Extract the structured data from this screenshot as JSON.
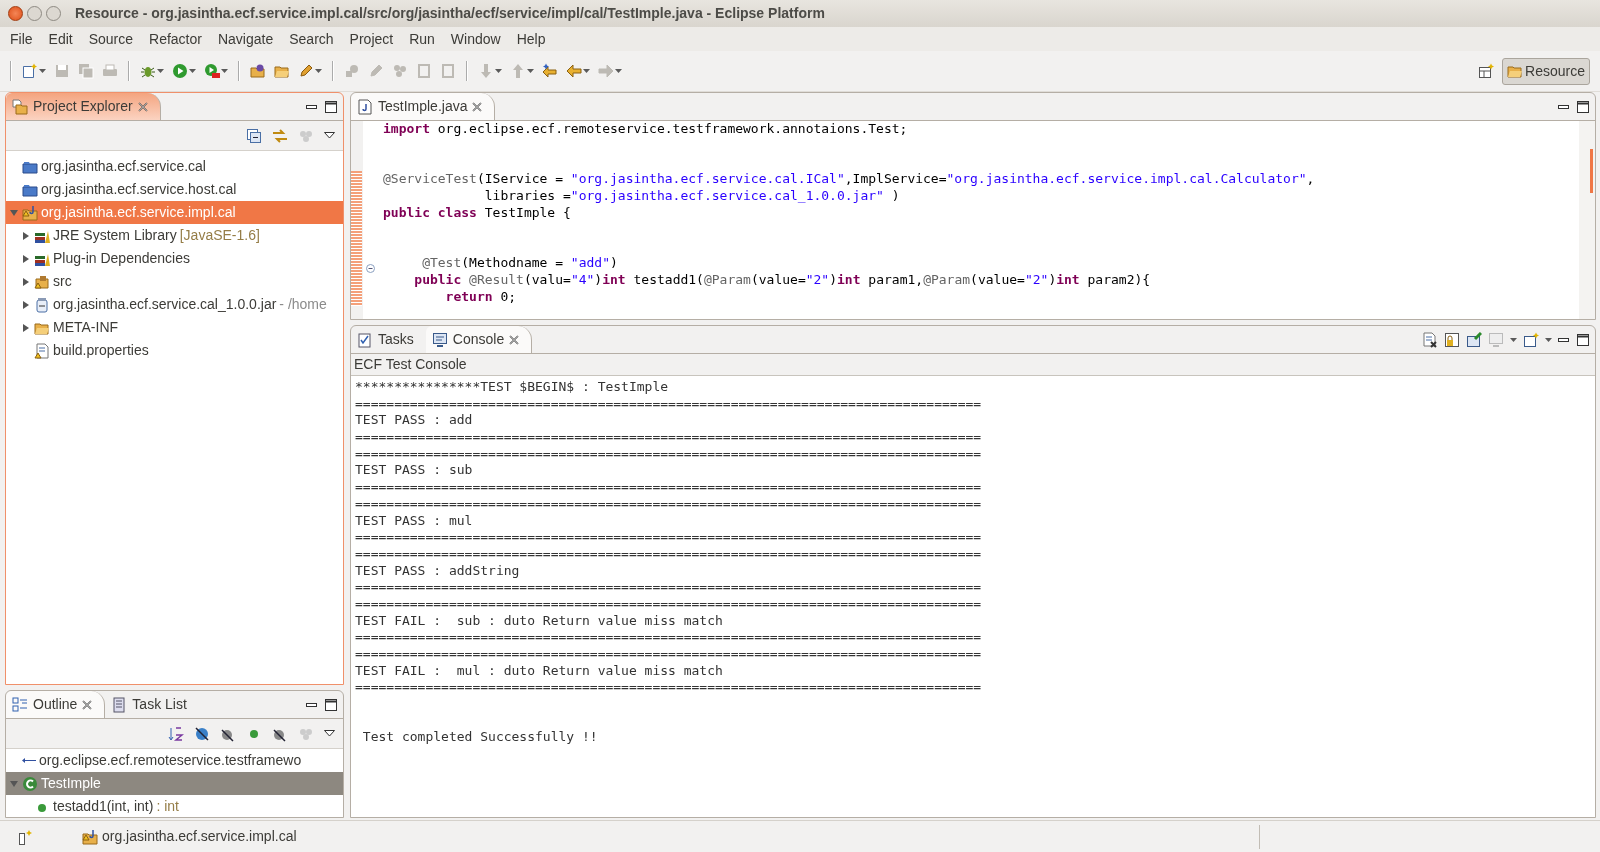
{
  "window": {
    "title": "Resource - org.jasintha.ecf.service.impl.cal/src/org/jasintha/ecf/service/impl/cal/TestImple.java - Eclipse Platform"
  },
  "menu": [
    "File",
    "Edit",
    "Source",
    "Refactor",
    "Navigate",
    "Search",
    "Project",
    "Run",
    "Window",
    "Help"
  ],
  "toolbar": [
    [
      {
        "kind": "new",
        "disabled": false,
        "dropdown": true
      },
      {
        "kind": "save",
        "disabled": true
      },
      {
        "kind": "save_all",
        "disabled": true
      },
      {
        "kind": "print",
        "disabled": true
      }
    ],
    [
      {
        "kind": "debug",
        "disabled": false,
        "dropdown": true
      },
      {
        "kind": "run",
        "disabled": false,
        "dropdown": true
      },
      {
        "kind": "external",
        "disabled": false,
        "dropdown": true
      }
    ],
    [
      {
        "kind": "open_type",
        "disabled": false
      },
      {
        "kind": "open_folder",
        "disabled": false
      },
      {
        "kind": "pen",
        "disabled": false,
        "dropdown": true
      }
    ],
    [
      {
        "kind": "marker",
        "disabled": true
      },
      {
        "kind": "pen",
        "disabled": true
      },
      {
        "kind": "dots",
        "disabled": true
      },
      {
        "kind": "square",
        "disabled": true
      },
      {
        "kind": "square",
        "disabled": true
      }
    ],
    [
      {
        "kind": "down",
        "disabled": true,
        "dropdown": true
      },
      {
        "kind": "up",
        "disabled": true,
        "dropdown": true
      },
      {
        "kind": "last_edit",
        "disabled": false
      },
      {
        "kind": "back",
        "disabled": false,
        "dropdown": true
      },
      {
        "kind": "forward",
        "disabled": true,
        "dropdown": true
      }
    ]
  ],
  "perspectives": [
    {
      "label": "Resource",
      "selected": true
    }
  ],
  "project_explorer": {
    "title": "Project Explorer",
    "tree": [
      {
        "label": "org.jasintha.ecf.service.cal",
        "kind": "closed_project",
        "selected": false
      },
      {
        "label": "org.jasintha.ecf.service.host.cal",
        "kind": "closed_project",
        "selected": false
      },
      {
        "label": "org.jasintha.ecf.service.impl.cal",
        "kind": "project",
        "selected": true,
        "expanded": true,
        "children": [
          {
            "label": "JRE System Library",
            "suffix": "[JavaSE-1.6]",
            "kind": "library",
            "selected": false,
            "expanded": false
          },
          {
            "label": "Plug-in Dependencies",
            "kind": "library",
            "selected": false,
            "expanded": false
          },
          {
            "label": "src",
            "kind": "source",
            "selected": false,
            "expanded": false
          },
          {
            "label": "org.jasintha.ecf.service.cal_1.0.0.jar",
            "suffix": "- /home",
            "kind": "jar",
            "selected": false,
            "expanded": false
          },
          {
            "label": "META-INF",
            "kind": "folder",
            "selected": false,
            "expanded": false
          },
          {
            "label": "build.properties",
            "kind": "file",
            "selected": false
          }
        ]
      }
    ]
  },
  "outline": {
    "tabs": [
      {
        "label": "Outline",
        "selected": true
      },
      {
        "label": "Task List",
        "selected": false
      }
    ],
    "items": [
      {
        "label": "org.eclipse.ecf.remoteservice.testframewo",
        "kind": "imports",
        "selected": false
      },
      {
        "label": "TestImple",
        "kind": "class",
        "selected": true,
        "expanded": true,
        "children": [
          {
            "label": "testadd1(int, int)",
            "suffix": ": int",
            "kind": "method",
            "selected": false
          }
        ]
      }
    ]
  },
  "editor": {
    "tabs": [
      {
        "label": "TestImple.java",
        "selected": true
      }
    ],
    "lines": [
      {
        "kind": "code",
        "segments": [
          {
            "kind": "keyword",
            "text": "import"
          },
          {
            "kind": "plain",
            "text": " org.eclipse.ecf.remoteservice.testframework.annotaions.Test;"
          }
        ]
      },
      {
        "kind": "blank"
      },
      {
        "kind": "blank"
      },
      {
        "kind": "code",
        "segments": [
          {
            "kind": "annotation",
            "text": "@ServiceTest"
          },
          {
            "kind": "plain",
            "text": "(IService = "
          },
          {
            "kind": "string",
            "text": "\"org.jasintha.ecf.service.cal.ICal\""
          },
          {
            "kind": "plain",
            "text": ",ImplService="
          },
          {
            "kind": "string",
            "text": "\"org.jasintha.ecf.service.impl.cal.Calculator\""
          },
          {
            "kind": "plain",
            "text": ","
          }
        ]
      },
      {
        "kind": "code",
        "segments": [
          {
            "kind": "plain",
            "text": "             libraries ="
          },
          {
            "kind": "string",
            "text": "\"org.jasintha.ecf.service.cal_1.0.0.jar\""
          },
          {
            "kind": "plain",
            "text": " )"
          }
        ]
      },
      {
        "kind": "code",
        "segments": [
          {
            "kind": "keyword",
            "text": "public class"
          },
          {
            "kind": "plain",
            "text": " TestImple {"
          }
        ]
      },
      {
        "kind": "blank"
      },
      {
        "kind": "blank"
      },
      {
        "kind": "code",
        "folded": false,
        "segments": [
          {
            "kind": "annotation",
            "text": "     @Test"
          },
          {
            "kind": "plain",
            "text": "(Methodname = "
          },
          {
            "kind": "string",
            "text": "\"add\""
          },
          {
            "kind": "plain",
            "text": ")"
          }
        ]
      },
      {
        "kind": "code",
        "segments": [
          {
            "kind": "keyword",
            "text": "    public"
          },
          {
            "kind": "annotation",
            "text": " @Result"
          },
          {
            "kind": "plain",
            "text": "(valu="
          },
          {
            "kind": "string",
            "text": "\"4\""
          },
          {
            "kind": "plain",
            "text": ")"
          },
          {
            "kind": "keyword",
            "text": "int"
          },
          {
            "kind": "plain",
            "text": " testadd1("
          },
          {
            "kind": "annotation",
            "text": "@Param"
          },
          {
            "kind": "plain",
            "text": "(value="
          },
          {
            "kind": "string",
            "text": "\"2\""
          },
          {
            "kind": "plain",
            "text": ")"
          },
          {
            "kind": "keyword",
            "text": "int"
          },
          {
            "kind": "plain",
            "text": " param1,"
          },
          {
            "kind": "annotation",
            "text": "@Param"
          },
          {
            "kind": "plain",
            "text": "(value="
          },
          {
            "kind": "string",
            "text": "\"2\""
          },
          {
            "kind": "plain",
            "text": ")"
          },
          {
            "kind": "keyword",
            "text": "int"
          },
          {
            "kind": "plain",
            "text": " param2){"
          }
        ]
      },
      {
        "kind": "code",
        "segments": [
          {
            "kind": "keyword",
            "text": "        return"
          },
          {
            "kind": "plain",
            "text": " 0;"
          }
        ]
      }
    ]
  },
  "bottom_panel": {
    "tabs": [
      {
        "label": "Tasks",
        "selected": false
      },
      {
        "label": "Console",
        "selected": true
      }
    ],
    "console_title": "ECF Test Console",
    "lines": [
      {
        "kind": "text",
        "text": "****************TEST $BEGIN$ : TestImple"
      },
      {
        "kind": "text",
        "text": "================================================================================"
      },
      {
        "kind": "text",
        "text": "TEST PASS : add"
      },
      {
        "kind": "text",
        "text": "================================================================================"
      },
      {
        "kind": "text",
        "text": "================================================================================"
      },
      {
        "kind": "text",
        "text": "TEST PASS : sub"
      },
      {
        "kind": "text",
        "text": "================================================================================"
      },
      {
        "kind": "text",
        "text": "================================================================================"
      },
      {
        "kind": "text",
        "text": "TEST PASS : mul"
      },
      {
        "kind": "text",
        "text": "================================================================================"
      },
      {
        "kind": "text",
        "text": "================================================================================"
      },
      {
        "kind": "text",
        "text": "TEST PASS : addString"
      },
      {
        "kind": "text",
        "text": "================================================================================"
      },
      {
        "kind": "text",
        "text": "================================================================================"
      },
      {
        "kind": "text",
        "text": "TEST FAIL :  sub : duto Return value miss match"
      },
      {
        "kind": "text",
        "text": "================================================================================"
      },
      {
        "kind": "text",
        "text": "================================================================================"
      },
      {
        "kind": "text",
        "text": "TEST FAIL :  mul : duto Return value miss match"
      },
      {
        "kind": "text",
        "text": "================================================================================"
      },
      {
        "kind": "blank"
      },
      {
        "kind": "blank"
      },
      {
        "kind": "text",
        "text": " Test completed Successfully !!"
      }
    ]
  },
  "status_bar": {
    "text": "org.jasintha.ecf.service.impl.cal"
  }
}
